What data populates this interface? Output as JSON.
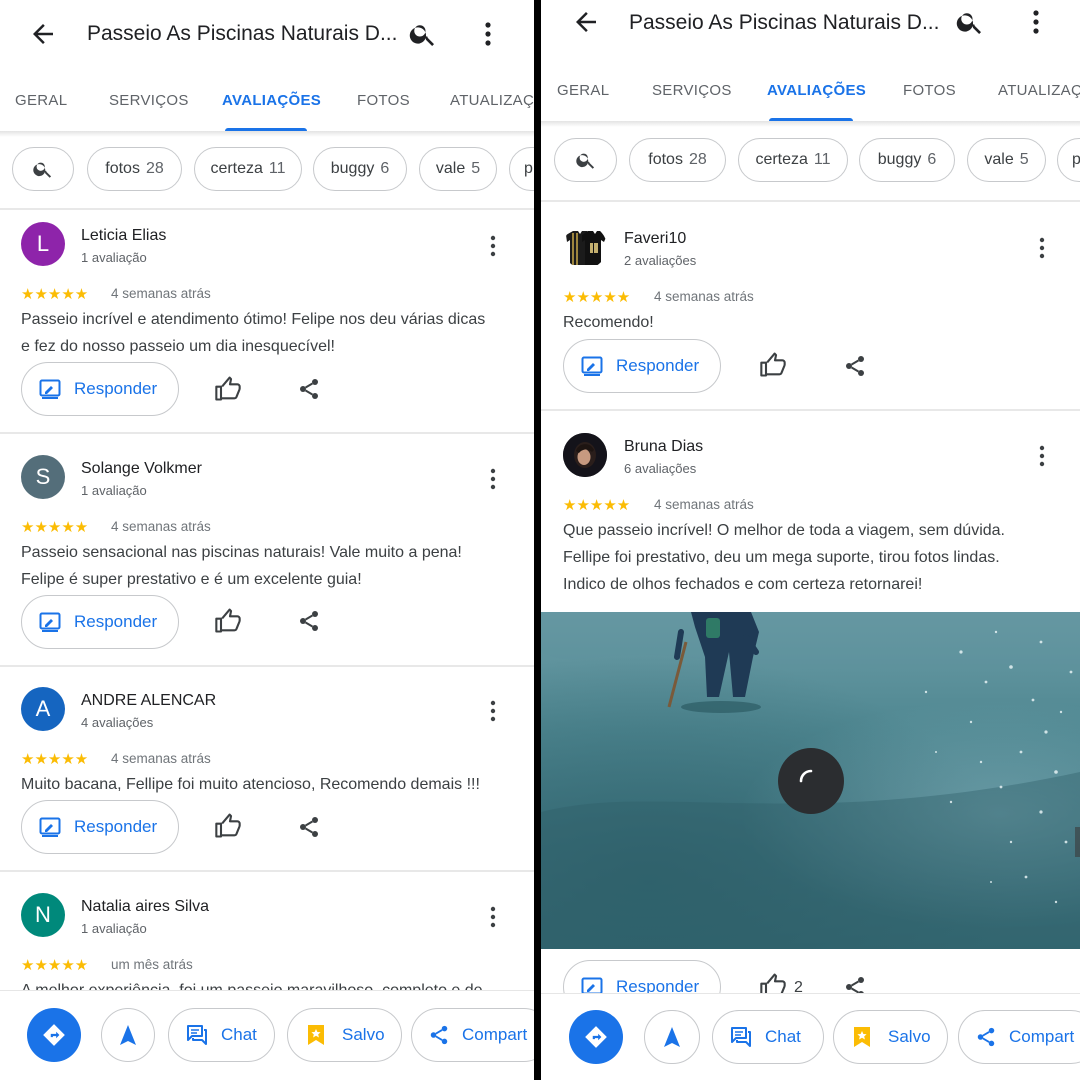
{
  "colors": {
    "accent": "#1a73e8",
    "star": "#fbbc04"
  },
  "left": {
    "header": {
      "title": "Passeio As Piscinas Naturais D..."
    },
    "tabs": [
      "GERAL",
      "SERVIÇOS",
      "AVALIAÇÕES",
      "FOTOS",
      "ATUALIZAÇ"
    ],
    "active_tab": "AVALIAÇÕES",
    "chips": [
      {
        "label": "fotos",
        "count": "28"
      },
      {
        "label": "certeza",
        "count": "11"
      },
      {
        "label": "buggy",
        "count": "6"
      },
      {
        "label": "vale",
        "count": "5"
      },
      {
        "label": "p",
        "count": ""
      }
    ],
    "reviews": [
      {
        "initial": "L",
        "avatar_color": "#8e24aa",
        "name": "Leticia Elias",
        "count": "1 avaliação",
        "stars": "★★★★★",
        "date": "4 semanas atrás",
        "text": "Passeio incrível e atendimento ótimo! Felipe nos deu várias dicas\ne fez do nosso passeio um dia inesquecível!",
        "reply": "Responder"
      },
      {
        "initial": "S",
        "avatar_color": "#546e7a",
        "name": "Solange Volkmer",
        "count": "1 avaliação",
        "stars": "★★★★★",
        "date": "4 semanas atrás",
        "text": "Passeio sensacional nas piscinas naturais! Vale muito a pena!\nFelipe é super prestativo e é um excelente guia!",
        "reply": "Responder"
      },
      {
        "initial": "A",
        "avatar_color": "#1565c0",
        "name": "ANDRE ALENCAR",
        "count": "4 avaliações",
        "stars": "★★★★★",
        "date": "4 semanas atrás",
        "text": "Muito bacana, Fellipe foi muito atencioso, Recomendo demais !!!",
        "reply": "Responder"
      },
      {
        "initial": "N",
        "avatar_color": "#00897b",
        "name": "Natalia aires Silva",
        "count": "1 avaliação",
        "stars": "★★★★★",
        "date": "um mês atrás",
        "text": "A melhor experiência, foi um passeio maravilhoso, completo e de",
        "reply": ""
      }
    ],
    "bottom": {
      "chat": "Chat",
      "salvo": "Salvo",
      "share": "Compart"
    }
  },
  "right": {
    "header": {
      "title": "Passeio As Piscinas Naturais D..."
    },
    "tabs": [
      "GERAL",
      "SERVIÇOS",
      "AVALIAÇÕES",
      "FOTOS",
      "ATUALIZAÇ"
    ],
    "active_tab": "AVALIAÇÕES",
    "chips": [
      {
        "label": "fotos",
        "count": "28"
      },
      {
        "label": "certeza",
        "count": "11"
      },
      {
        "label": "buggy",
        "count": "6"
      },
      {
        "label": "vale",
        "count": "5"
      },
      {
        "label": "p",
        "count": ""
      }
    ],
    "reviews": [
      {
        "name": "Faveri10",
        "count": "2 avaliações",
        "stars": "★★★★★",
        "date": "4 semanas atrás",
        "text": "Recomendo!",
        "reply": "Responder"
      },
      {
        "name": "Bruna Dias",
        "count": "6 avaliações",
        "stars": "★★★★★",
        "date": "4 semanas atrás",
        "text": "Que passeio incrível! O melhor de toda a viagem, sem dúvida.\nFellipe foi prestativo, deu um mega suporte, tirou fotos lindas.\nIndico de olhos fechados e com certeza retornarei!",
        "reply": "Responder",
        "likes": "2"
      }
    ],
    "bottom": {
      "chat": "Chat",
      "salvo": "Salvo",
      "share": "Compart"
    }
  }
}
